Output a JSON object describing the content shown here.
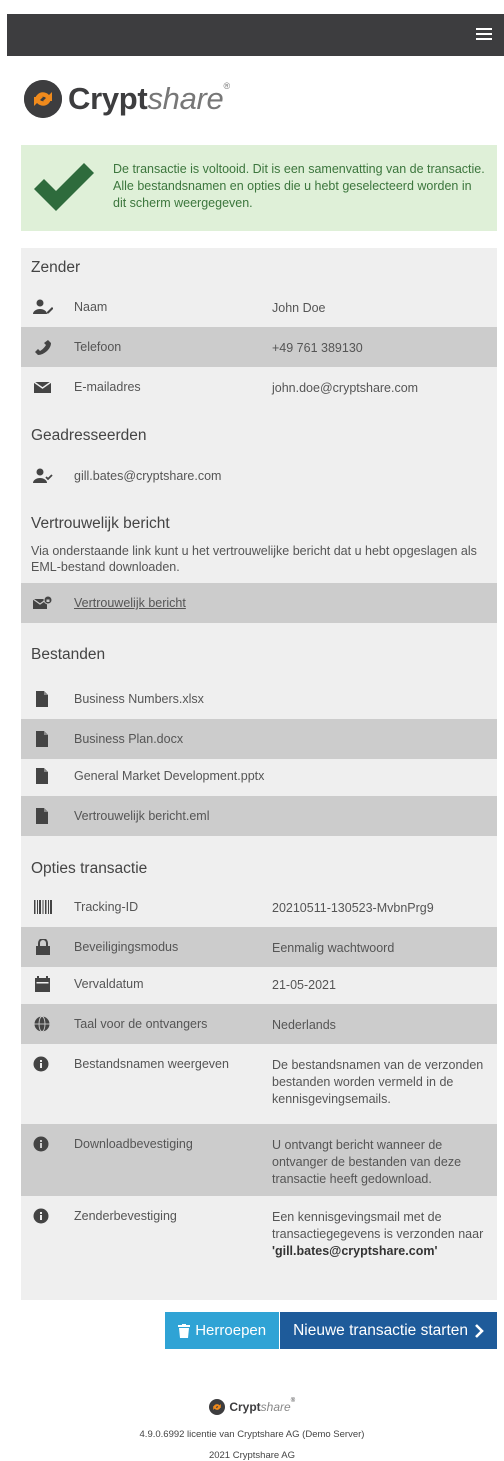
{
  "brand": {
    "name_bold": "Crypt",
    "name_light": "share",
    "reg": "®"
  },
  "success_message": "De transactie is voltooid. Dit is een samenvatting van de transactie. Alle bestandsnamen en opties die u hebt geselecteerd worden in dit scherm weergegeven.",
  "sender": {
    "title": "Zender",
    "rows": [
      {
        "icon": "user-edit-icon",
        "label": "Naam",
        "value": "John Doe"
      },
      {
        "icon": "phone-icon",
        "label": "Telefoon",
        "value": "+49 761 389130"
      },
      {
        "icon": "envelope-icon",
        "label": "E-mailadres",
        "value": "john.doe@cryptshare.com"
      }
    ]
  },
  "recipients": {
    "title": "Geadresseerden",
    "rows": [
      {
        "icon": "user-check-icon",
        "label": "gill.bates@cryptshare.com"
      }
    ]
  },
  "confidential": {
    "title": "Vertrouwelijk bericht",
    "description": "Via onderstaande link kunt u het vertrouwelijke bericht dat u hebt opgeslagen als EML-bestand downloaden.",
    "link_label": "Vertrouwelijk bericht"
  },
  "files": {
    "title": "Bestanden",
    "items": [
      "Business Numbers.xlsx",
      "Business Plan.docx",
      "General Market Development.pptx",
      "Vertrouwelijk bericht.eml"
    ]
  },
  "options": {
    "title": "Opties transactie",
    "rows": [
      {
        "icon": "barcode-icon",
        "label": "Tracking-ID",
        "value": "20210511-130523-MvbnPrg9"
      },
      {
        "icon": "lock-icon",
        "label": "Beveiligingsmodus",
        "value": "Eenmalig wachtwoord"
      },
      {
        "icon": "calendar-icon",
        "label": "Vervaldatum",
        "value": "21-05-2021"
      },
      {
        "icon": "globe-icon",
        "label": "Taal voor de ontvangers",
        "value": "Nederlands"
      },
      {
        "icon": "info-icon",
        "label": "Bestandsnamen weergeven",
        "value": "De bestandsnamen van de verzonden bestanden worden vermeld in de kennisgevingsemails."
      },
      {
        "icon": "info-icon",
        "label": "Downloadbevestiging",
        "value": "U ontvangt bericht wanneer de ontvanger de bestanden van deze transactie heeft gedownload."
      },
      {
        "icon": "info-icon",
        "label": "Zenderbevestiging",
        "value_prefix": "Een kennisgevingsmail met de transactiegegevens is verzonden naar",
        "value_email": "'gill.bates@cryptshare.com'"
      }
    ]
  },
  "buttons": {
    "recall": "Herroepen",
    "new_transaction": "Nieuwe transactie starten"
  },
  "footer": {
    "version": "4.9.0.6992 licentie van Cryptshare AG (Demo Server)",
    "copyright": "2021 Cryptshare AG"
  },
  "colors": {
    "topbar": "#3d3d3f",
    "success_bg": "#dff0d8",
    "check": "#2e6b3c",
    "recall": "#2fa3d5",
    "new": "#1e5b9a"
  }
}
